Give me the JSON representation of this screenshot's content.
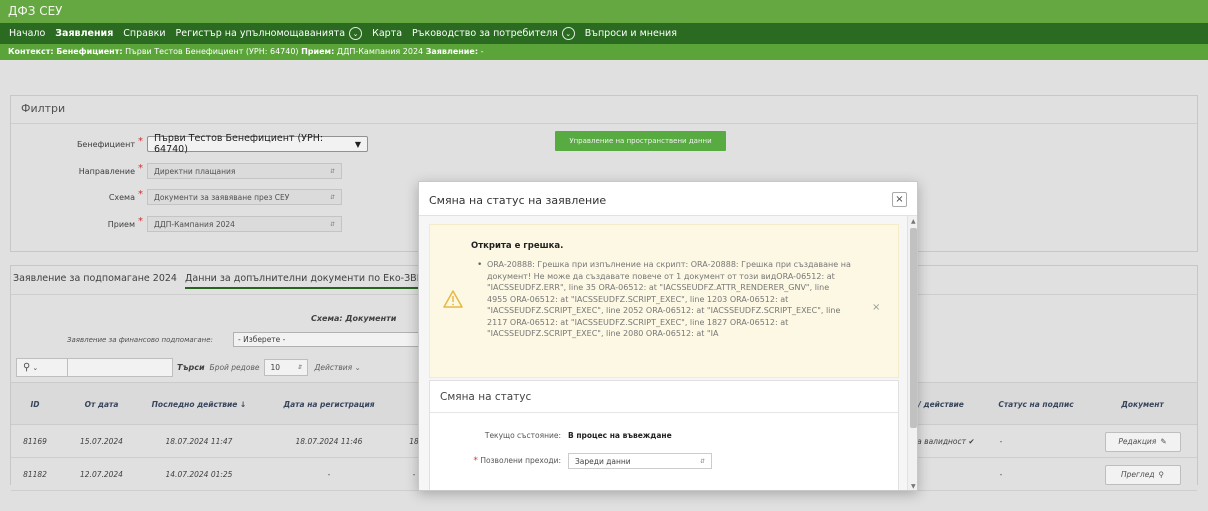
{
  "app": {
    "title": "ДФЗ СЕУ"
  },
  "nav": {
    "items": [
      {
        "label": "Начало"
      },
      {
        "label": "Заявления"
      },
      {
        "label": "Справки"
      },
      {
        "label": "Регистър на упълномощаванията"
      },
      {
        "label": "Карта"
      },
      {
        "label": "Ръководство за потребителя"
      },
      {
        "label": "Въпроси и мнения"
      }
    ]
  },
  "context": {
    "context_label": "Контекст:",
    "beneficiary_label": "Бенефициент:",
    "beneficiary_value": "Първи Тестов Бенефициент (УРН: 64740)",
    "campaign_label": "Прием:",
    "campaign_value": "ДДП-Кампания 2024",
    "application_label": "Заявление:",
    "application_value": "-"
  },
  "filters": {
    "title": "Филтри",
    "beneficiary": {
      "label": "Бенефициент",
      "value": "Първи Тестов Бенефициент (УРН: 64740)"
    },
    "direction": {
      "label": "Направление",
      "value": "Директни плащания"
    },
    "scheme": {
      "label": "Схема",
      "value": "Документи за заявяване през СЕУ"
    },
    "intake": {
      "label": "Прием",
      "value": "ДДП-Кампания 2024"
    },
    "spatial_button": "Управление на пространствени данни"
  },
  "tabs": [
    {
      "label": "Заявление за подпомагане 2024"
    },
    {
      "label": "Данни за допълнителни документи по Еко-ЗВПП, Ек"
    }
  ],
  "grid": {
    "schema_label": "Схема: Документи",
    "app_support_label": "Заявление за финансово подпомагане:",
    "app_support_value": "- Изберете -",
    "search_button": "Търси",
    "rows_label": "Брой редове",
    "rows_value": "10",
    "actions_label": "Действия",
    "columns": [
      "ID",
      "От дата",
      "Последно действие",
      "Дата на регистрация",
      "/ действие",
      "Статус на подпис",
      "Документ"
    ],
    "rows": [
      {
        "id": "81169",
        "from": "15.07.2024",
        "last": "18.07.2024 11:47",
        "reg": "18.07.2024 11:46",
        "reg_extra": "18",
        "action": "ед за валидност",
        "sign": "-",
        "doc": "Редакция"
      },
      {
        "id": "81182",
        "from": "12.07.2024",
        "last": "14.07.2024 01:25",
        "reg": "-",
        "reg_extra": "-",
        "action": "",
        "sign": "-",
        "doc": "Преглед"
      }
    ]
  },
  "modal": {
    "title": "Смяна на статус на заявление",
    "close": "×",
    "alert": {
      "heading": "Открита е грешка.",
      "bullet": "•",
      "message": "ORA-20888: Грешка при изпълнение на скрипт: ORA-20888: Грешка при създаване на документ! Не може да създавате повече от 1 документ от този видORA-06512: at \"IACSSEUDFZ.ERR\", line 35 ORA-06512: at \"IACSSEUDFZ.ATTR_RENDERER_GNV\", line 4955 ORA-06512: at \"IACSSEUDFZ.SCRIPT_EXEC\", line 1203 ORA-06512: at \"IACSSEUDFZ.SCRIPT_EXEC\", line 2052 ORA-06512: at \"IACSSEUDFZ.SCRIPT_EXEC\", line 2117 ORA-06512: at \"IACSSEUDFZ.SCRIPT_EXEC\", line 1827 ORA-06512: at \"IACSSEUDFZ.SCRIPT_EXEC\", line 2080 ORA-06512: at \"IA",
      "close": "×"
    },
    "status": {
      "title": "Смяна на статус",
      "current_label": "Текущо състояние:",
      "current_value": "В процес на въвеждане",
      "transitions_label": "Позволени преходи:",
      "transitions_value": "Зареди данни"
    }
  },
  "colors": {
    "title_bar": "#65a841",
    "nav_bar": "#2a6b21",
    "context_bar": "#5aa43a",
    "button": "#5cb544",
    "alert_bg": "#fcf8e3"
  }
}
